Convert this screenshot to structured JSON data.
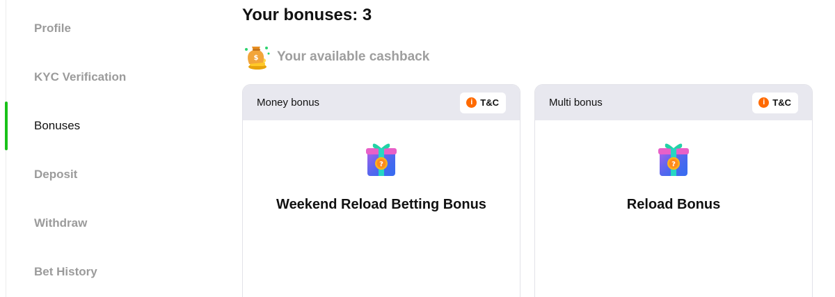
{
  "sidebar": {
    "items": [
      {
        "label": "Profile"
      },
      {
        "label": "KYC Verification"
      },
      {
        "label": "Bonuses"
      },
      {
        "label": "Deposit"
      },
      {
        "label": "Withdraw"
      },
      {
        "label": "Bet History"
      }
    ],
    "active_index": 2
  },
  "main": {
    "title": "Your bonuses: 3",
    "cashback": {
      "icon": "money-bag-icon",
      "label": "Your available cashback"
    }
  },
  "cards": [
    {
      "type": "Money bonus",
      "tc_label": "T&C",
      "icon": "gift-box-icon",
      "title": "Weekend Reload Betting Bonus"
    },
    {
      "type": "Multi bonus",
      "tc_label": "T&C",
      "icon": "gift-box-icon",
      "title": "Reload Bonus"
    }
  ],
  "colors": {
    "accent": "#19c219",
    "info": "#ff6a00",
    "header_bg": "#e8e8ef",
    "muted_text": "#9b9b9b"
  }
}
